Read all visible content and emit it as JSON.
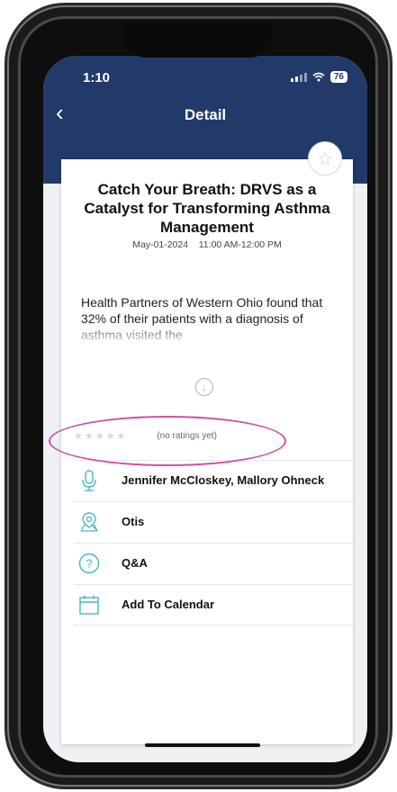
{
  "status": {
    "time": "1:10",
    "battery": "76"
  },
  "nav": {
    "title": "Detail"
  },
  "session": {
    "title": "Catch Your Breath: DRVS as a Catalyst for Transforming Asthma Management",
    "date": "May-01-2024",
    "time": "11:00 AM-12:00 PM",
    "description": "Health Partners of Western Ohio found that 32% of their patients with a diagnosis of asthma visited the"
  },
  "rating": {
    "value": 0,
    "max": 5,
    "label": "(no ratings yet)"
  },
  "rows": [
    {
      "icon": "microphone-icon",
      "label": "Jennifer McCloskey, Mallory Ohneck"
    },
    {
      "icon": "location-pin-icon",
      "label": "Otis"
    },
    {
      "icon": "question-icon",
      "label": "Q&A"
    },
    {
      "icon": "calendar-icon",
      "label": "Add To Calendar"
    }
  ],
  "colors": {
    "header": "#223a69",
    "accent": "#45b8c2",
    "highlight": "#d14f9d"
  }
}
